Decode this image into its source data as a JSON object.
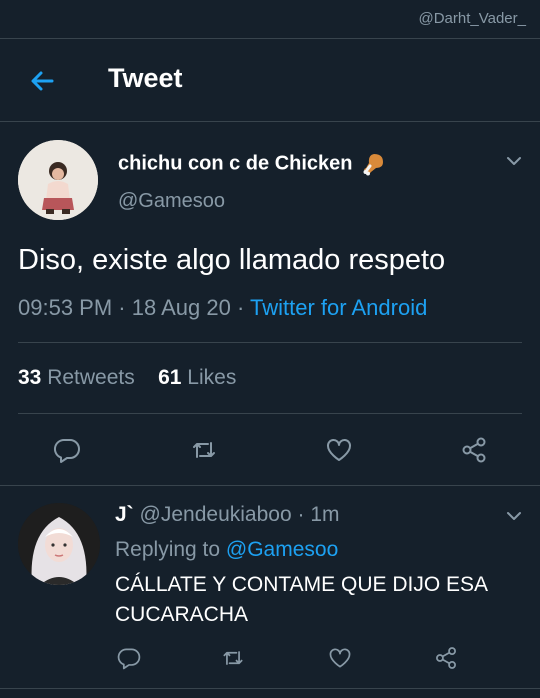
{
  "watermark": "@Darht_Vader_",
  "header": {
    "title": "Tweet"
  },
  "tweet": {
    "display_name": "chichu con c de Chicken",
    "handle": "@Gamesoo",
    "text": "Diso, existe algo llamado respeto",
    "time": "09:53 PM",
    "date": "18 Aug 20",
    "client": "Twitter for Android",
    "retweets_count": "33",
    "retweets_label": "Retweets",
    "likes_count": "61",
    "likes_label": "Likes"
  },
  "reply": {
    "display_name": "J`",
    "handle": "@Jendeukiaboo",
    "time": "1m",
    "replying_label": "Replying to",
    "replying_to": "@Gamesoo",
    "text": "CÁLLATE Y CONTAME QUE DIJO ESA CUCARACHA"
  },
  "colors": {
    "background": "#15202b",
    "accent": "#1da1f2",
    "muted": "#8899a6",
    "divider": "#38444d"
  },
  "icons": [
    "back-arrow-icon",
    "chevron-down-icon",
    "reply-icon",
    "retweet-icon",
    "like-icon",
    "share-icon",
    "drumstick-emoji-icon"
  ]
}
